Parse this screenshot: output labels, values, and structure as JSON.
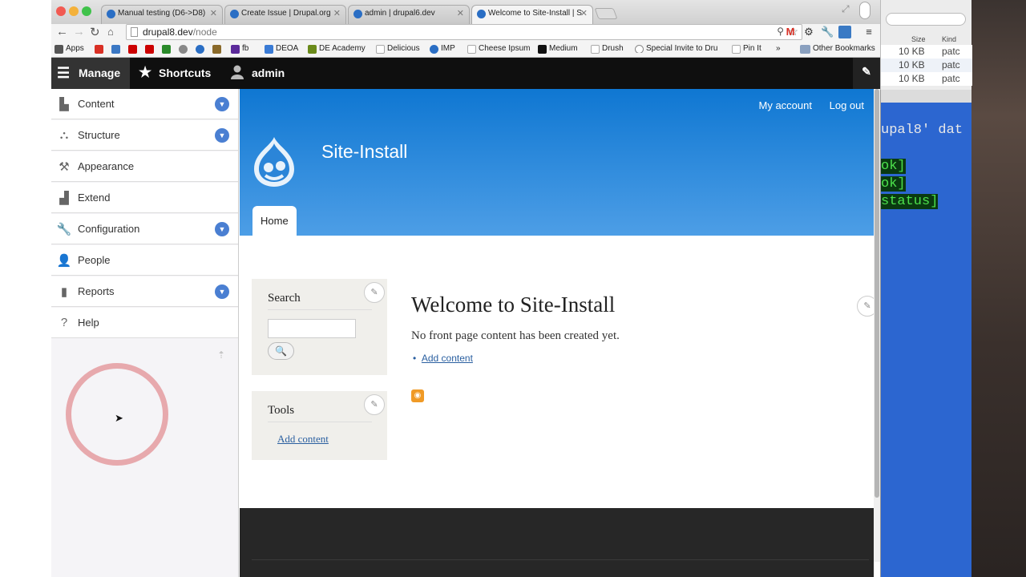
{
  "browser": {
    "tabs": [
      {
        "title": "Manual testing (D6->D8)"
      },
      {
        "title": "Create Issue | Drupal.org"
      },
      {
        "title": "admin | drupal6.dev"
      },
      {
        "title": "Welcome to Site-Install | S"
      }
    ],
    "url_host": "drupal8.dev",
    "url_path": "/node",
    "bookmarks": [
      {
        "label": "Apps",
        "color": "#555"
      },
      {
        "label": "",
        "color": "#d93025"
      },
      {
        "label": "",
        "color": "#3b78c4"
      },
      {
        "label": "",
        "color": "#cc0000"
      },
      {
        "label": "",
        "color": "#c00"
      },
      {
        "label": "",
        "color": "#2a8a2a"
      },
      {
        "label": "",
        "color": "#888"
      },
      {
        "label": "",
        "color": "#2a6ec4"
      },
      {
        "label": "",
        "color": "#8a6a2a"
      },
      {
        "label": "fb",
        "color": "#5b2a9a"
      },
      {
        "label": "DEOA",
        "color": "#3a7bd5"
      },
      {
        "label": "DE Academy",
        "color": "#6a8a1a"
      },
      {
        "label": "Delicious",
        "color": "#ffffff"
      },
      {
        "label": "IMP",
        "color": "#2a6ec4"
      },
      {
        "label": "Cheese Ipsum",
        "color": "#ffffff"
      },
      {
        "label": "Medium",
        "color": "#111"
      },
      {
        "label": "Drush",
        "color": "#ffffff"
      },
      {
        "label": "Special Invite to Dru",
        "color": "#888"
      },
      {
        "label": "Pin It",
        "color": "#ffffff"
      }
    ],
    "bookmarks_more": "»",
    "other_bookmarks": "Other Bookmarks"
  },
  "toolbar": {
    "manage": "Manage",
    "shortcuts": "Shortcuts",
    "user": "admin"
  },
  "menu": [
    {
      "label": "Content",
      "icon": "content-icon",
      "expandable": true
    },
    {
      "label": "Structure",
      "icon": "structure-icon",
      "expandable": true
    },
    {
      "label": "Appearance",
      "icon": "appearance-icon",
      "expandable": false
    },
    {
      "label": "Extend",
      "icon": "extend-icon",
      "expandable": false
    },
    {
      "label": "Configuration",
      "icon": "configuration-icon",
      "expandable": true
    },
    {
      "label": "People",
      "icon": "people-icon",
      "expandable": false
    },
    {
      "label": "Reports",
      "icon": "reports-icon",
      "expandable": true
    },
    {
      "label": "Help",
      "icon": "help-icon",
      "expandable": false
    }
  ],
  "header": {
    "my_account": "My account",
    "log_out": "Log out",
    "site_name": "Site-Install",
    "home_tab": "Home"
  },
  "sidebar": {
    "search_title": "Search",
    "tools_title": "Tools",
    "tools_link": "Add content"
  },
  "content": {
    "title": "Welcome to Site-Install",
    "message": "No front page content has been created yet.",
    "add_content": "Add content"
  },
  "finder": {
    "col_size": "Size",
    "col_kind": "Kind",
    "rows": [
      {
        "size": "10 KB",
        "kind": "patc"
      },
      {
        "size": "10 KB",
        "kind": "patc"
      },
      {
        "size": "10 KB",
        "kind": "patc"
      }
    ]
  },
  "terminal": {
    "line1": "upal8' dat",
    "ok1": "ok]",
    "ok2": "ok]",
    "status": "status]"
  },
  "colors": {
    "header_top": "#0f77d2",
    "header_bottom": "#4d9ee6",
    "link": "#2a5fa0",
    "chevron": "#4a7fd2"
  }
}
